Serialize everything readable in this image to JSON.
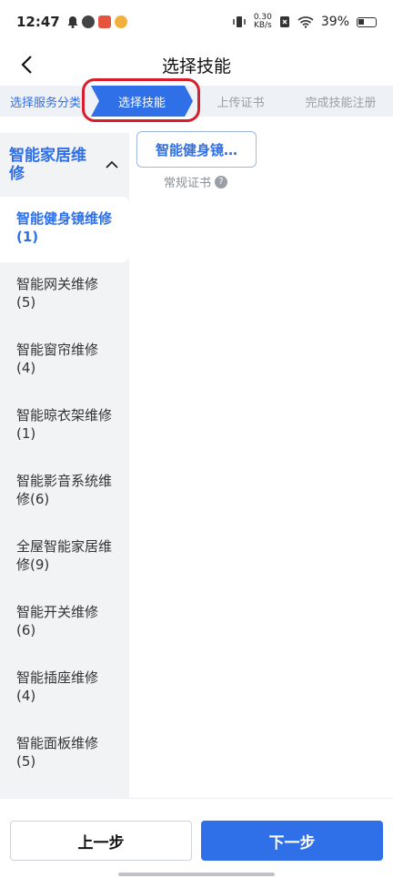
{
  "status": {
    "time": "12:47",
    "net_speed_top": "0.30",
    "net_speed_unit": "KB/s",
    "battery": "39%"
  },
  "header": {
    "title": "选择技能"
  },
  "steps": [
    {
      "label": "选择服务分类"
    },
    {
      "label": "选择技能"
    },
    {
      "label": "上传证书"
    },
    {
      "label": "完成技能注册"
    }
  ],
  "sidebar": {
    "group": "智能家居维修",
    "items": [
      {
        "name": "智能健身镜维修",
        "count": "(1)"
      },
      {
        "name": "智能网关维修",
        "count": "(5)"
      },
      {
        "name": "智能窗帘维修",
        "count": "(4)"
      },
      {
        "name": "智能晾衣架维修",
        "count": "(1)"
      },
      {
        "name": "智能影音系统维修",
        "count": "(6)"
      },
      {
        "name": "全屋智能家居维修",
        "count": "(9)"
      },
      {
        "name": "智能开关维修",
        "count": "(6)"
      },
      {
        "name": "智能插座维修",
        "count": "(4)"
      },
      {
        "name": "智能面板维修",
        "count": "(5)"
      }
    ]
  },
  "content": {
    "skill_card": "智能健身镜…",
    "cert_label": "常规证书",
    "help_glyph": "?"
  },
  "footer": {
    "prev_label": "上一步",
    "next_label": "下一步"
  },
  "colors": {
    "accent": "#2f6fe8",
    "highlight": "#d81e2c"
  }
}
